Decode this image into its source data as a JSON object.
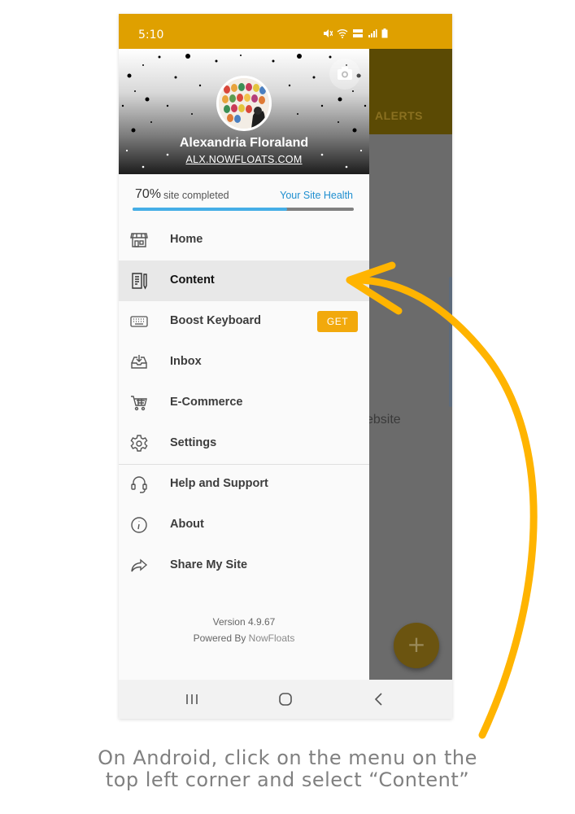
{
  "status_bar": {
    "time": "5:10",
    "icons": [
      "mute-icon",
      "wifi-icon",
      "volte-icon",
      "signal-icon",
      "battery-icon"
    ]
  },
  "background_app": {
    "tab_label": "ALERTS",
    "partial_text": "ebsite",
    "fab_label": "+"
  },
  "profile": {
    "name": "Alexandria Floraland",
    "site": "ALX.NOWFLOATS.COM"
  },
  "progress": {
    "percent_text": "70%",
    "label": "site completed",
    "health_link": "Your Site Health",
    "value": 0.7
  },
  "menu": {
    "items": [
      {
        "label": "Home",
        "icon": "store-icon"
      },
      {
        "label": "Content",
        "icon": "content-icon"
      },
      {
        "label": "Boost Keyboard",
        "icon": "keyboard-icon",
        "action": "GET"
      },
      {
        "label": "Inbox",
        "icon": "inbox-icon"
      },
      {
        "label": "E-Commerce",
        "icon": "cart-icon"
      },
      {
        "label": "Settings",
        "icon": "gear-icon"
      },
      {
        "label": "Help and Support",
        "icon": "headset-icon"
      },
      {
        "label": "About",
        "icon": "info-icon"
      },
      {
        "label": "Share My Site",
        "icon": "share-icon"
      }
    ]
  },
  "footer": {
    "version": "Version 4.9.67",
    "powered_prefix": "Powered By",
    "powered_brand": "NowFloats"
  },
  "nav_bar": {
    "buttons": [
      "recent-apps-icon",
      "home-circle-icon",
      "back-icon"
    ]
  },
  "caption": {
    "line1": "On Android, click on the menu on the",
    "line2": "top left corner and select “Content”"
  },
  "colors": {
    "status_bar": "#DFA000",
    "accent_orange": "#F2A90C",
    "arrow": "#FFB400",
    "link_blue": "#1f8fd0",
    "progress_fill": "#45aee6"
  }
}
